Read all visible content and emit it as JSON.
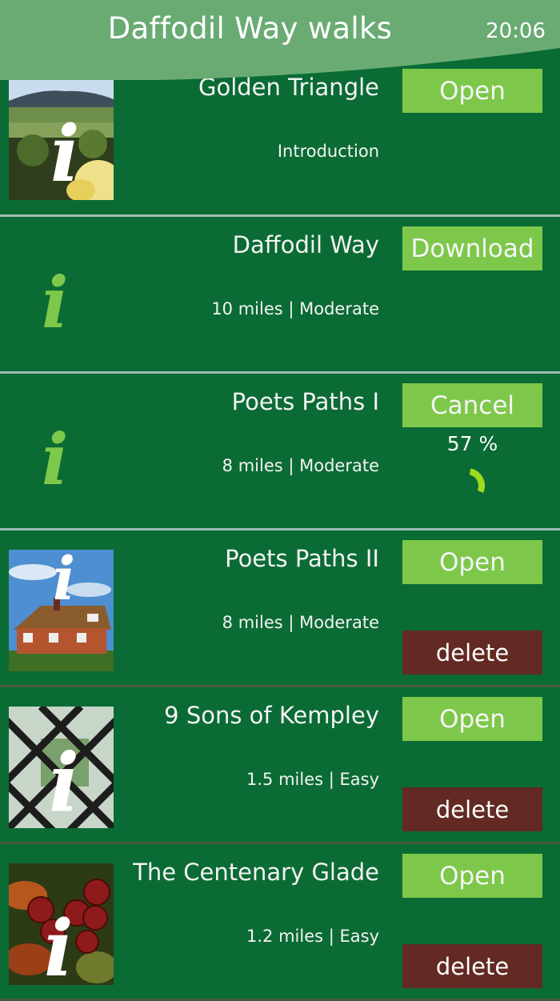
{
  "header": {
    "title": "Daffodil Way walks",
    "time": "20:06"
  },
  "colors": {
    "background": "#0b6b34",
    "header": "#6aab74",
    "button_green": "#7dc84a",
    "button_delete": "#622a22",
    "divider": "#9bbfb3",
    "info_green": "#7dc84a"
  },
  "walks": [
    {
      "name": "Golden Triangle",
      "detail": "Introduction",
      "button": "Open",
      "thumbnail": "hills-landscape-info-icon"
    },
    {
      "name": "Daffodil Way",
      "detail": "10 miles | Moderate",
      "button": "Download",
      "thumbnail": "info-icon"
    },
    {
      "name": "Poets Paths I",
      "detail": "8 miles | Moderate",
      "button": "Cancel",
      "progress_label": "57 %",
      "progress": 0.57,
      "thumbnail": "info-icon"
    },
    {
      "name": "Poets Paths II",
      "detail": "8 miles | Moderate",
      "button": "Open",
      "delete": "delete",
      "thumbnail": "cottage-info-icon"
    },
    {
      "name": "9 Sons of Kempley",
      "detail": "1.5 miles | Easy",
      "button": "Open",
      "delete": "delete",
      "thumbnail": "lattice-window-info-icon"
    },
    {
      "name": "The Centenary Glade",
      "detail": "1.2 miles | Easy",
      "button": "Open",
      "delete": "delete",
      "thumbnail": "berries-info-icon"
    }
  ]
}
